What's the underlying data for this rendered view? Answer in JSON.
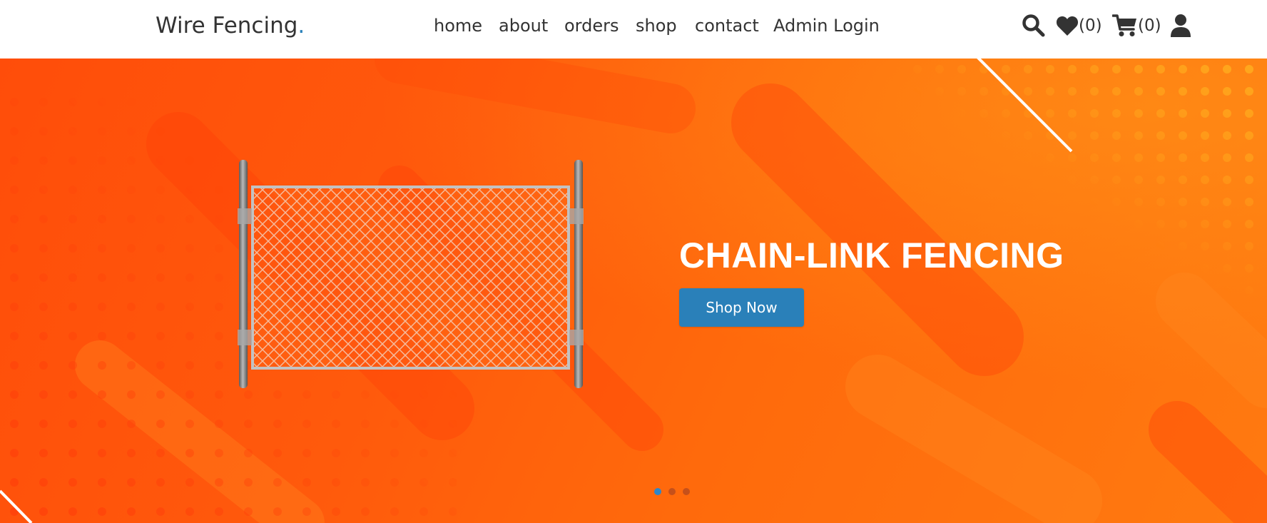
{
  "header": {
    "logo_text": "Wire Fencing",
    "logo_dot": ".",
    "nav": [
      "home",
      "about",
      "orders",
      "shop",
      "contact",
      "Admin Login"
    ],
    "wishlist_count": "(0)",
    "cart_count": "(0)",
    "icons": [
      "search-icon",
      "heart-icon",
      "cart-icon",
      "user-icon"
    ]
  },
  "hero": {
    "headline": "CHAIN-LINK FENCING",
    "button_label": "Shop Now",
    "slide_count": 3,
    "active_slide": 1
  },
  "colors": {
    "accent": "#2980b9",
    "hero_orange": "#ff5a0c",
    "button_blue": "#2a80b9",
    "text_dark": "#333333"
  }
}
